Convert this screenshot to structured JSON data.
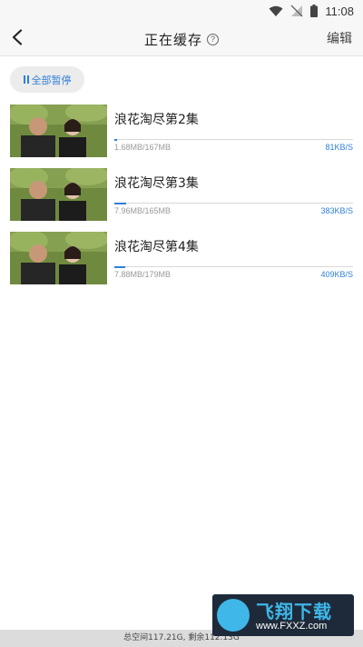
{
  "status_bar": {
    "time": "11:08"
  },
  "header": {
    "title": "正在缓存",
    "help_glyph": "?",
    "edit_label": "编辑"
  },
  "toolbar": {
    "pause_all_label": "全部暂停"
  },
  "downloads": [
    {
      "title": "浪花淘尽第2集",
      "size": "1.68MB/167MB",
      "speed": "81KB/S",
      "progress": 0.01
    },
    {
      "title": "浪花淘尽第3集",
      "size": "7.96MB/165MB",
      "speed": "383KB/S",
      "progress": 0.048
    },
    {
      "title": "浪花淘尽第4集",
      "size": "7.88MB/179MB",
      "speed": "409KB/S",
      "progress": 0.044
    }
  ],
  "footer": {
    "storage_text": "总空间117.21G, 剩余112.13G"
  },
  "watermark": {
    "top_text": "飞翔下载",
    "bottom_text": "www.FXXZ.com"
  },
  "colors": {
    "accent": "#2f7fd8",
    "header_bg": "#f7f7f7",
    "footer_bg": "#dcdcdc"
  }
}
